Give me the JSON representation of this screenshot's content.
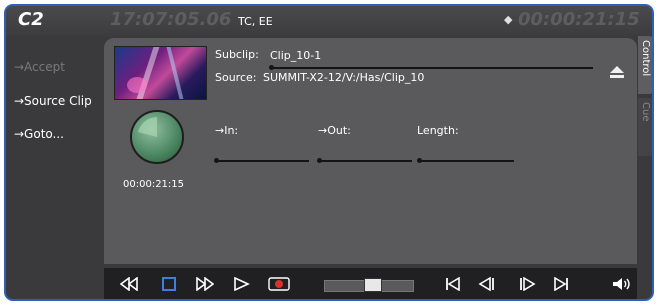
{
  "header": {
    "channel": "C2",
    "timecode": "17:07:05.06",
    "tc_mode": "TC, EE",
    "duration": "00:00:21:15"
  },
  "sidebar": {
    "items": [
      {
        "label": "→Accept",
        "enabled": false
      },
      {
        "label": "→Source Clip",
        "enabled": true
      },
      {
        "label": "→Goto...",
        "enabled": true
      }
    ]
  },
  "clip": {
    "subclip_label": "Subclip:",
    "subclip_name": "Clip_10-1",
    "source_label": "Source:",
    "source_value": "SUMMIT-X2-12/V:/Has/Clip_10",
    "in_label": "→In:",
    "out_label": "→Out:",
    "length_label": "Length:",
    "clock_time": "00:00:21:15"
  },
  "tabs": [
    {
      "label": "Control",
      "active": true
    },
    {
      "label": "Cue",
      "active": false
    }
  ],
  "transport": {
    "shuttle_position": 0.55
  },
  "icons": {
    "duration": "duration-icon",
    "eject": "eject-icon",
    "rewind": "rewind-icon",
    "stop": "stop-icon",
    "fast_forward": "fast-forward-icon",
    "play": "play-icon",
    "record": "record-icon",
    "go_start": "go-to-start-icon",
    "step_back": "step-back-icon",
    "step_forward": "step-forward-icon",
    "go_end": "go-to-end-icon",
    "volume": "volume-icon"
  },
  "colors": {
    "accent": "#2f5fb8",
    "record": "#d8322e",
    "stop": "#3d7fe0",
    "clock": "#3f7a55"
  }
}
